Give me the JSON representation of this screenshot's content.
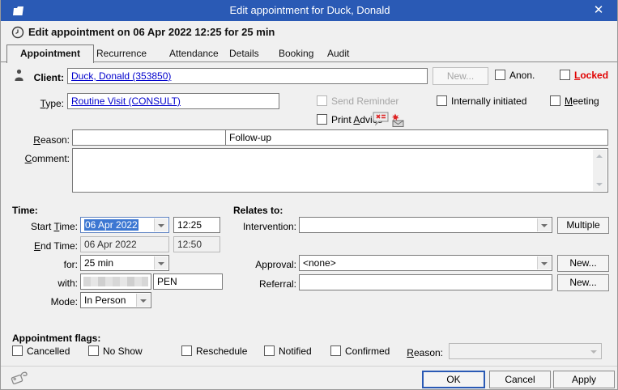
{
  "window": {
    "title": "Edit appointment for Duck, Donald",
    "close_glyph": "✕"
  },
  "header": {
    "text": "Edit appointment on 06 Apr 2022 12:25 for 25 min"
  },
  "tabs": [
    {
      "label": "Appointment",
      "selected": true
    },
    {
      "label": "Recurrence",
      "selected": false
    },
    {
      "label": "Attendance",
      "selected": false
    },
    {
      "label": "Details",
      "selected": false
    },
    {
      "label": "Booking",
      "selected": false
    },
    {
      "label": "Audit",
      "selected": false
    }
  ],
  "client": {
    "label": "Client:",
    "value": "Duck, Donald (353850)",
    "new_button": "New...",
    "anon_label": "Anon.",
    "locked_label": "Locked"
  },
  "type": {
    "label": "Type:",
    "value": "Routine Visit (CONSULT)"
  },
  "checks": {
    "send_reminder": "Send Reminder",
    "internally_initiated": "Internally initiated",
    "meeting": "Meeting",
    "print_advice": "Print Advice"
  },
  "reason": {
    "label": "Reason:",
    "value1": "",
    "value2": "Follow-up"
  },
  "comment": {
    "label": "Comment:",
    "value": ""
  },
  "time": {
    "section_label": "Time:",
    "start": {
      "label": "Start Time:",
      "date": "06 Apr 2022",
      "time": "12:25"
    },
    "end": {
      "label": "End Time:",
      "date": "06 Apr 2022",
      "time": "12:50"
    },
    "for": {
      "label": "for:",
      "value": "25 min"
    },
    "with": {
      "label": "with:",
      "value2": "PEN"
    },
    "mode": {
      "label": "Mode:",
      "value": "In Person"
    }
  },
  "relates": {
    "section_label": "Relates to:",
    "intervention": {
      "label": "Intervention:",
      "value": "",
      "button": "Multiple"
    },
    "approval": {
      "label": "Approval:",
      "value": "<none>",
      "button": "New..."
    },
    "referral": {
      "label": "Referral:",
      "value": "",
      "button": "New..."
    }
  },
  "flags": {
    "section_label": "Appointment flags:",
    "items": [
      "Cancelled",
      "No Show",
      "Reschedule",
      "Notified",
      "Confirmed"
    ],
    "reason_label": "Reason:",
    "reason_value": ""
  },
  "footer": {
    "ok": "OK",
    "cancel": "Cancel",
    "apply": "Apply"
  }
}
